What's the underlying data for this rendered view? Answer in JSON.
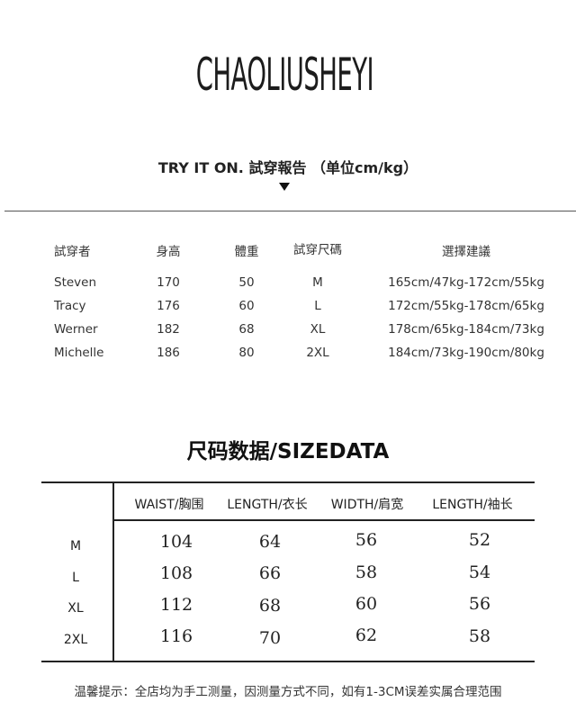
{
  "brand": "CHAOLIUSHEYI",
  "try_on": {
    "title": "TRY IT ON. 試穿報告 （单位cm/kg）",
    "headers": [
      "試穿者",
      "身高",
      "體重",
      "試穿尺碼",
      "選擇建議"
    ],
    "rows": [
      [
        "Steven",
        "170",
        "50",
        "M",
        "165cm/47kg-172cm/55kg"
      ],
      [
        "Tracy",
        "176",
        "60",
        "L",
        "172cm/55kg-178cm/65kg"
      ],
      [
        "Werner",
        "182",
        "68",
        "XL",
        "178cm/65kg-184cm/73kg"
      ],
      [
        "Michelle",
        "186",
        "80",
        "2XL",
        "184cm/73kg-190cm/80kg"
      ]
    ]
  },
  "size_data": {
    "title": "尺码数据/SIZEDATA",
    "headers": [
      "WAIST/胸围",
      "LENGTH/衣长",
      "WIDTH/肩宽",
      "LENGTH/袖长"
    ],
    "rows": [
      {
        "size": "M",
        "values": [
          "104",
          "64",
          "56",
          "52"
        ]
      },
      {
        "size": "L",
        "values": [
          "108",
          "66",
          "58",
          "54"
        ]
      },
      {
        "size": "XL",
        "values": [
          "112",
          "68",
          "60",
          "56"
        ]
      },
      {
        "size": "2XL",
        "values": [
          "116",
          "70",
          "62",
          "58"
        ]
      }
    ]
  },
  "notice": "温馨提示：全店均为手工测量，因测量方式不同，如有1-3CM误差实属合理范围"
}
